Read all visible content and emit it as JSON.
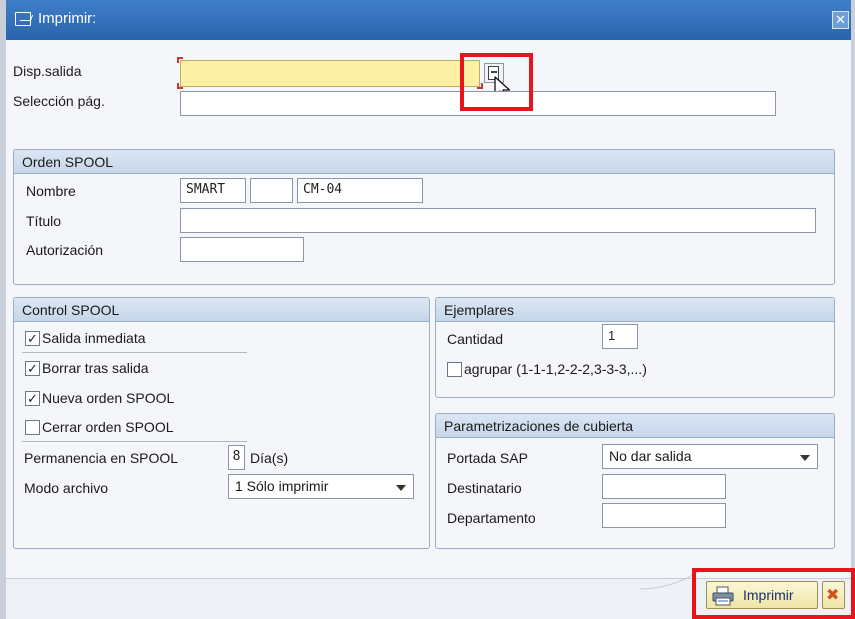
{
  "window": {
    "title": "Imprimir:",
    "close_glyph": "✕"
  },
  "fields": {
    "output_device_label": "Disp.salida",
    "output_device_value": "",
    "page_selection_label": "Selección pág.",
    "page_selection_value": ""
  },
  "spool_request": {
    "header": "Orden SPOOL",
    "name_label": "Nombre",
    "name_part1": "SMART",
    "name_part2": "",
    "name_part3": "CM-04",
    "title_label": "Título",
    "title_value": "",
    "authorization_label": "Autorización",
    "authorization_value": ""
  },
  "spool_control": {
    "header": "Control SPOOL",
    "checkboxes": [
      {
        "label": "Salida inmediata",
        "checked": true
      },
      {
        "label": "Borrar tras salida",
        "checked": true
      },
      {
        "label": "Nueva orden SPOOL",
        "checked": true
      },
      {
        "label": "Cerrar orden SPOOL",
        "checked": false
      }
    ],
    "retention_label": "Permanencia en SPOOL",
    "retention_value": "8",
    "retention_unit": "Día(s)",
    "archive_mode_label": "Modo archivo",
    "archive_mode_value": "1 Sólo imprimir"
  },
  "copies": {
    "header": "Ejemplares",
    "quantity_label": "Cantidad",
    "quantity_value": "1",
    "collate_label": "agrupar (1-1-1,2-2-2,3-3-3,...)",
    "collate_checked": false
  },
  "cover_page": {
    "header": "Parametrizaciones de cubierta",
    "sap_cover_label": "Portada SAP",
    "sap_cover_value": "No dar salida",
    "recipient_label": "Destinatario",
    "recipient_value": "",
    "department_label": "Departamento",
    "department_value": ""
  },
  "footer": {
    "print_label": "Imprimir",
    "cancel_glyph": "✖"
  },
  "colors": {
    "titlebar": "#2f6db8",
    "required_field": "#fbf0a3",
    "highlight_box": "#e8141b",
    "cancel_icon": "#d1541c"
  },
  "icons": {
    "title": "print-dialog-icon",
    "possible_entries": "possible-entries-icon",
    "print": "printer-icon",
    "cancel": "cancel-icon",
    "pointer": "mouse-cursor-icon"
  }
}
